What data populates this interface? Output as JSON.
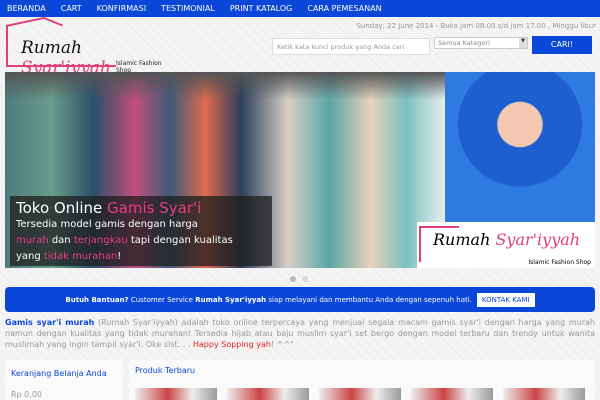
{
  "nav": [
    "BERANDA",
    "CART",
    "KONFIRMASI",
    "TESTIMONIAL",
    "PRINT KATALOG",
    "CARA PEMESANAN"
  ],
  "header": {
    "logo_name": "Rumah",
    "logo_name2": "Syar'iyyah",
    "logo_tag": "Islamic Fashion Shop",
    "date": "Sunday, 22 June 2014 - Buka jam 08.00 s/d jam 17.00 , Minggu libur",
    "search_placeholder": "Ketik kata kunci produk yang Anda cari",
    "category": "Semua Kategori",
    "search_button": "CARI!"
  },
  "hero": {
    "title1": "Toko Online ",
    "title2": "Gamis Syar'i",
    "l1": "Tersedia model gamis dengan harga",
    "l2a": "murah",
    "l2b": " dan ",
    "l2c": "terjangkau",
    "l2d": " tapi dengan kualitas",
    "l3a": "yang ",
    "l3b": "tidak murahan",
    "l3c": "!",
    "logo_name": "Rumah",
    "logo_name2": "Syar'iyyah",
    "logo_tag": "Islamic Fashion Shop"
  },
  "help": {
    "q": "Butuh Bantuan?",
    "t1": "Customer Service",
    "brand": "Rumah Syar'iyyah",
    "t2": "siap melayani dan membantu Anda dengan sepenuh hati.",
    "button": "KONTAK KAMI"
  },
  "intro": {
    "bold": "Gamis syar'i murah",
    "text": " (Rumah Syar'iyyah) adalah toko online terpercaya yang menjual segala macam gamis syar'i dengan harga yang murah namun dengan kualitas yang tidak murahan! Tersedia hijab atau baju muslim syar'i set bergo dengan model terbaru dan trendy untuk wanita muslimah yang ingin tampil syar'i. Oke sist. . . ",
    "red": "Happy Sopping yah",
    "end": "! ^^\""
  },
  "cart": {
    "title": "Keranjang Belanja Anda",
    "total": "Rp 0,00"
  },
  "products": {
    "title": "Produk Terbaru"
  }
}
